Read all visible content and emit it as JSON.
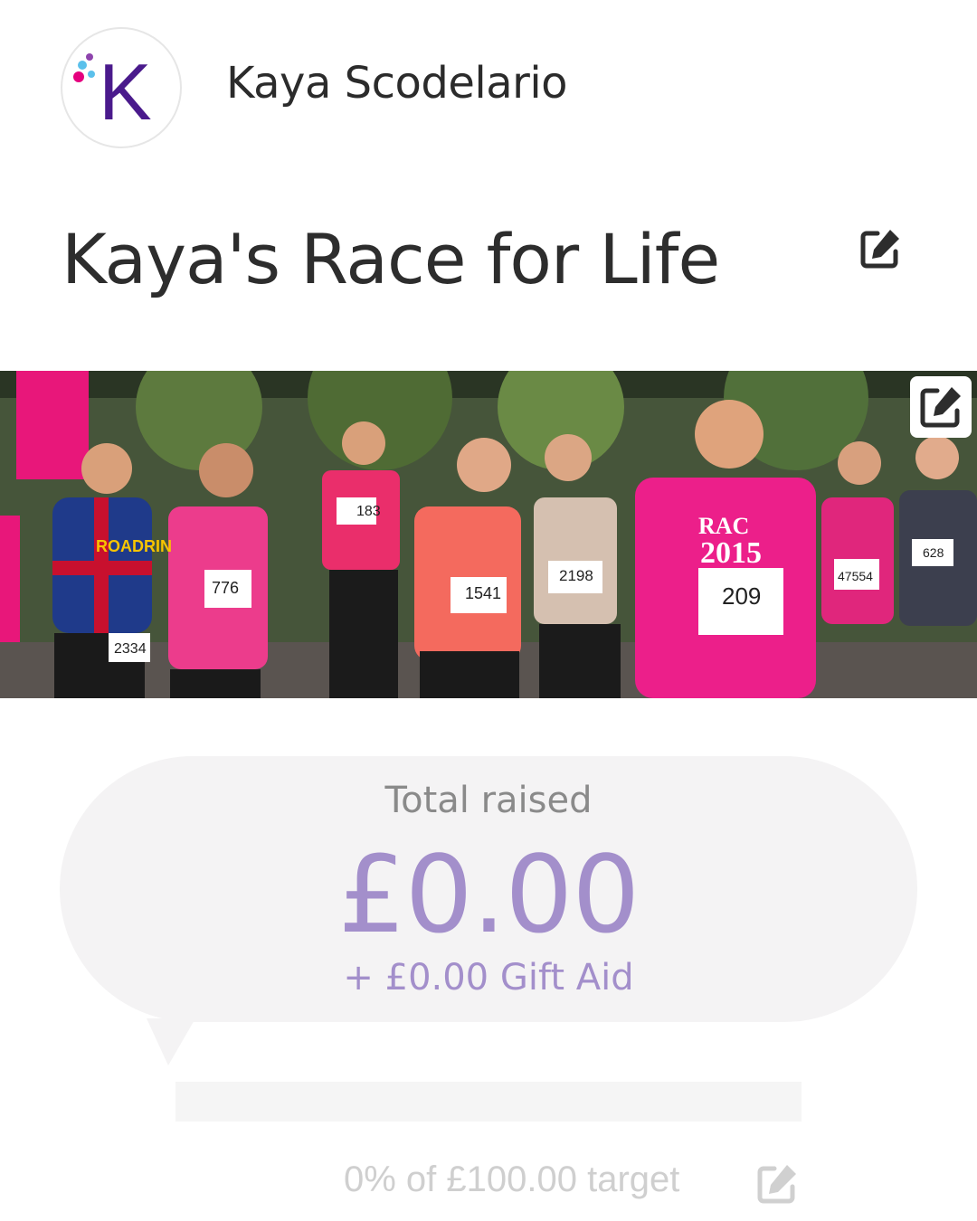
{
  "profile": {
    "name": "Kaya Scodelario",
    "avatar_letter": "K",
    "avatar_color": "#4a1a8c",
    "avatar_dot_colors": [
      "#5bc0eb",
      "#e5007e",
      "#8e44ad"
    ]
  },
  "page": {
    "title": "Kaya's Race for Life",
    "edit_icon": "edit-icon"
  },
  "banner": {
    "description_icon": "photo",
    "edit_icon": "edit-icon",
    "bib_numbers": [
      "183",
      "776",
      "2334",
      "1541",
      "2198",
      "209",
      "47554",
      "628"
    ],
    "shirt_text": [
      "RAC",
      "2015"
    ],
    "sign_text": "ROADRIN"
  },
  "fundraising": {
    "total_label": "Total raised",
    "total_amount": "£0.00",
    "gift_aid": "+ £0.00 Gift Aid",
    "progress_fraction": 0,
    "target_text": "0% of £100.00 target",
    "edit_icon": "edit-icon"
  },
  "colors": {
    "accent": "#a38fcb",
    "bubble": "#f4f3f4",
    "title_text": "#2d2d2d",
    "muted_text": "#8a8a8a",
    "target_text": "#cfcfcf",
    "race_pink": "#e8177a"
  }
}
